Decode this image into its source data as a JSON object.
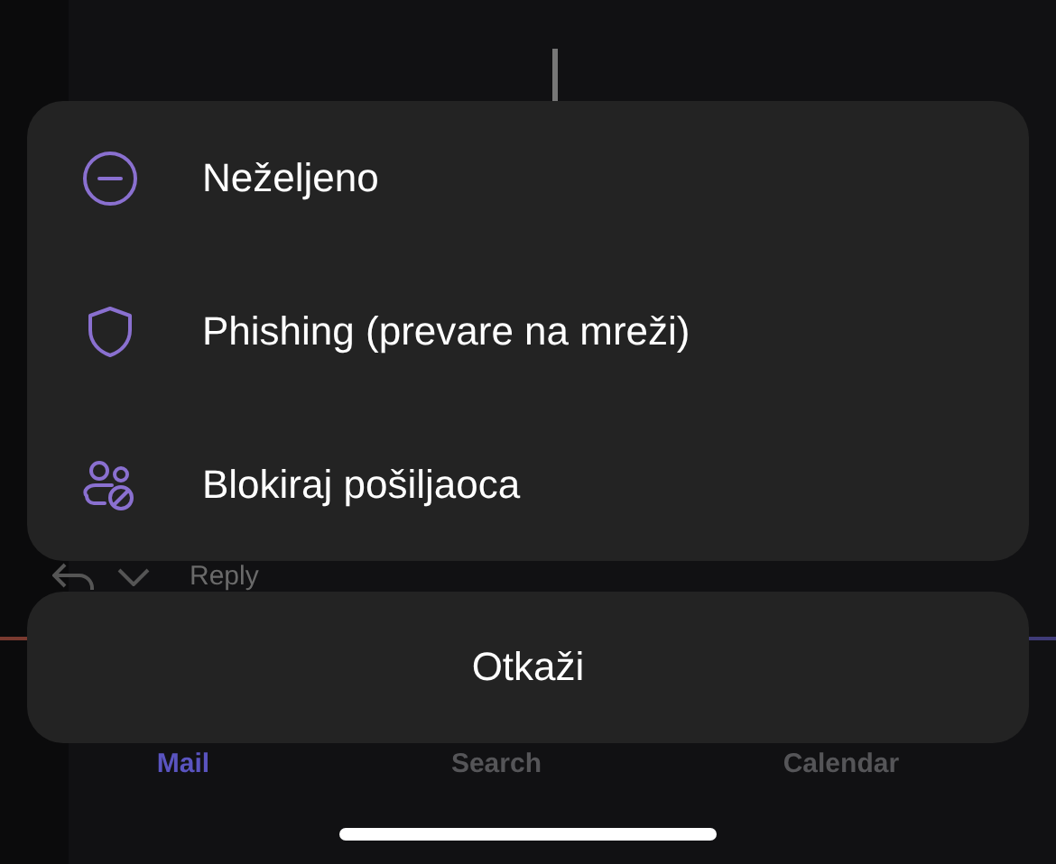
{
  "background": {
    "reply_label": "Reply",
    "tabs": [
      {
        "label": "Mail",
        "selected": true
      },
      {
        "label": "Search",
        "selected": false
      },
      {
        "label": "Calendar",
        "selected": false
      }
    ]
  },
  "sheet": {
    "items": [
      {
        "kind": "junk",
        "label": "Neželjeno"
      },
      {
        "kind": "phishing",
        "label": "Phishing (prevare na mreži)"
      },
      {
        "kind": "block",
        "label": "Blokiraj pošiljaoca"
      }
    ],
    "cancel": "Otkaži"
  }
}
